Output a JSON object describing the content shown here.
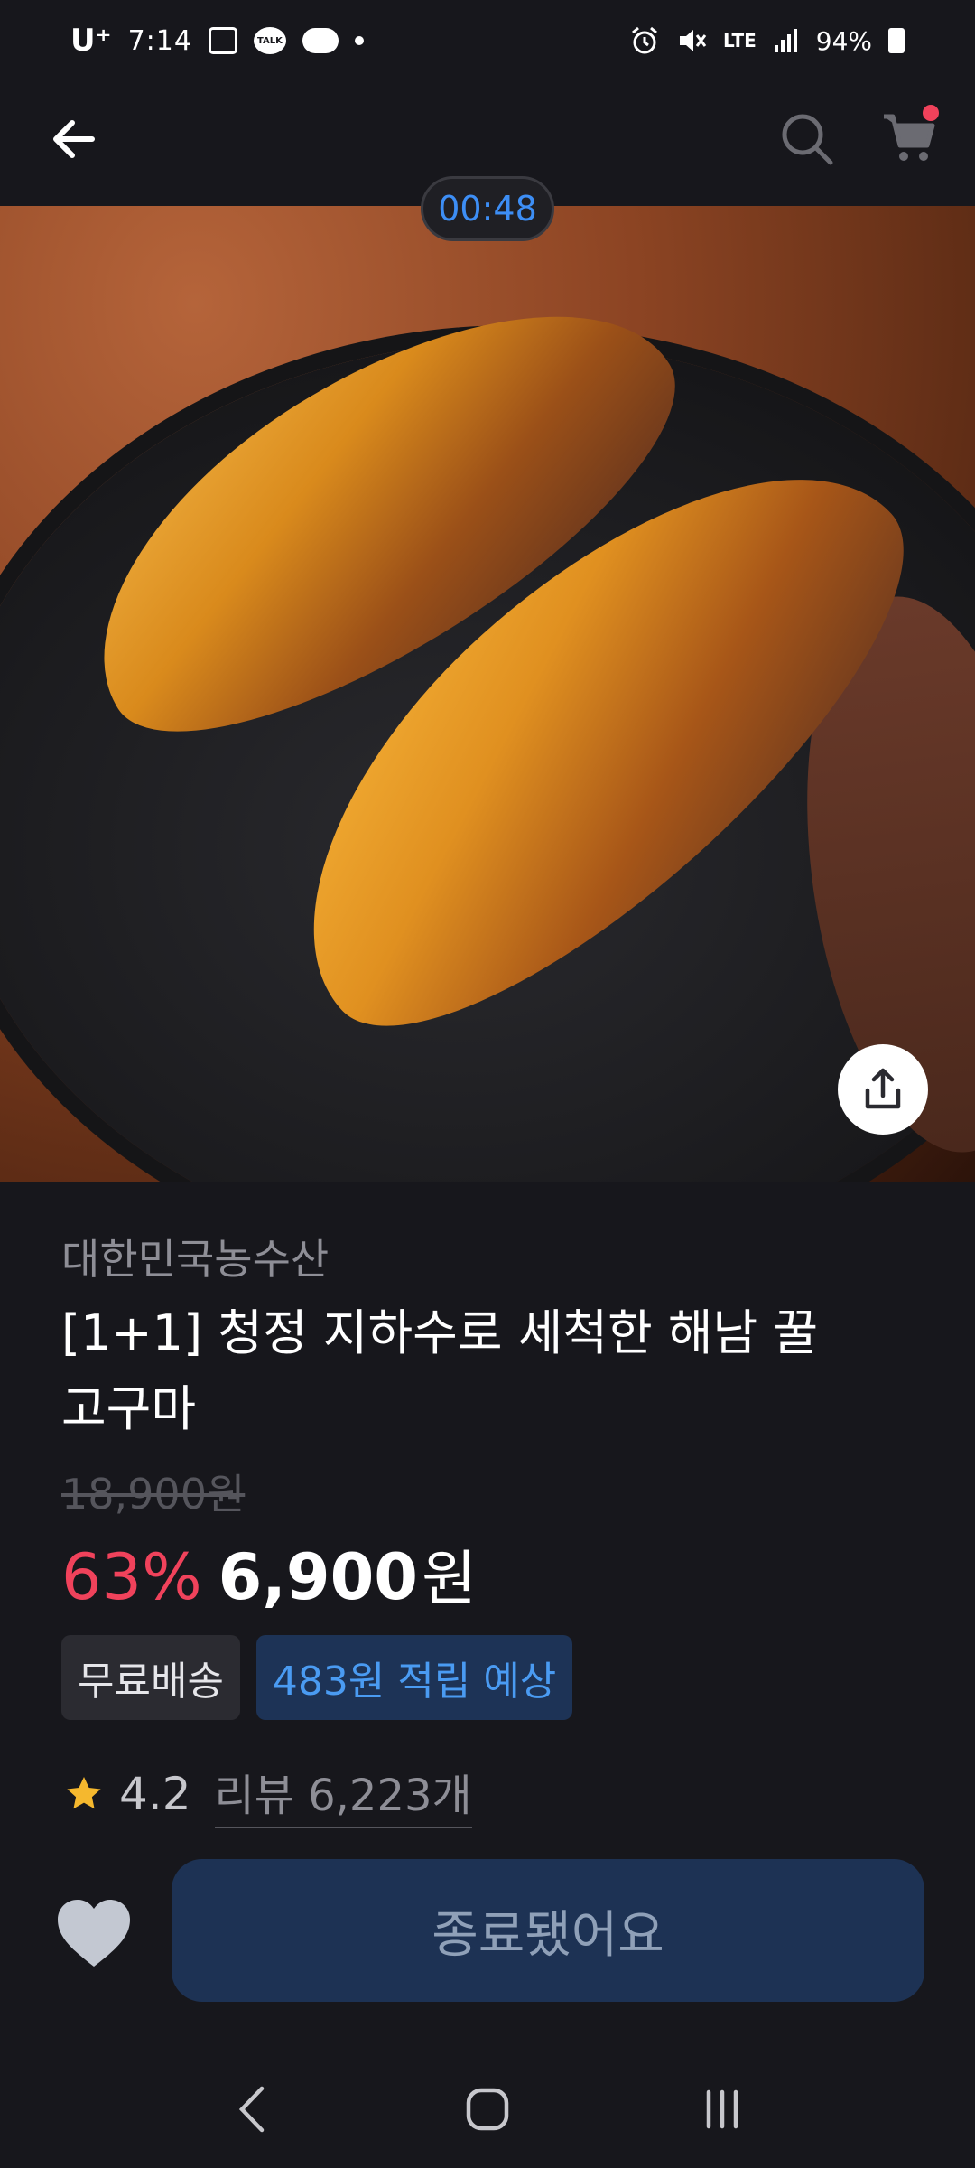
{
  "status_bar": {
    "carrier": "U⁺",
    "time": "7:14",
    "network": "LTE",
    "battery": "94%",
    "icons": [
      "gallery-icon",
      "kakaotalk-icon",
      "cloud-icon",
      "notification-dot-icon",
      "alarm-icon",
      "mute-icon",
      "lte-icon",
      "signal-icon",
      "battery-icon"
    ]
  },
  "app_bar": {
    "icons": [
      "back-arrow-icon",
      "search-icon",
      "cart-icon"
    ]
  },
  "hero": {
    "timer": "00:48",
    "share_icon": "share-icon"
  },
  "product": {
    "seller": "대한민국농수산",
    "title": "[1+1] 청정 지하수로 세척한 해남 꿀 고구마",
    "original_price": "18,900원",
    "discount": "63%",
    "price": "6,900",
    "price_unit": "원",
    "badges": [
      "무료배송",
      "483원 적립 예상"
    ],
    "rating": "4.2",
    "reviews": "리뷰 6,223개"
  },
  "bottom": {
    "buy_label": "종료됐어요",
    "heart_icon": "heart-icon"
  },
  "colors": {
    "background": "#17171c",
    "accent_blue": "#3d8ef5",
    "discount_red": "#f0425b",
    "button_bg": "#1d3254"
  }
}
